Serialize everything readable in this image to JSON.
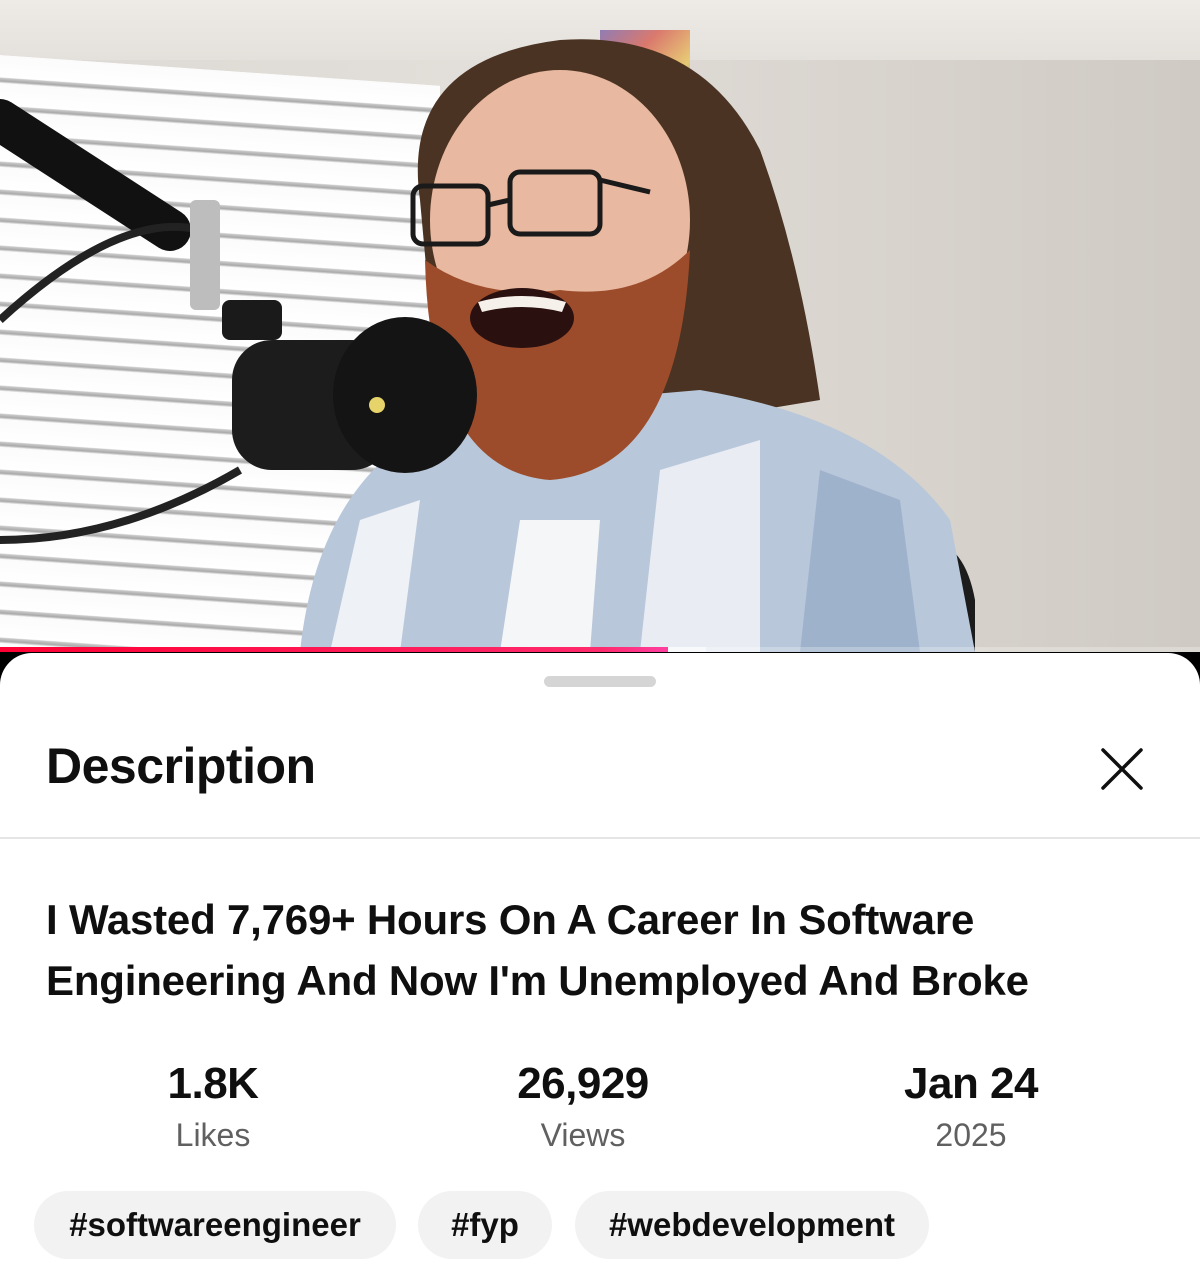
{
  "video": {
    "progress_played": 0.557,
    "progress_buffered": 0.588,
    "accent_color": "#ff0033"
  },
  "sheet": {
    "title": "Description",
    "close_icon": "close-icon"
  },
  "details": {
    "title": "I Wasted 7,769+ Hours On A Career In Software Engineering And Now I'm Unemployed And Broke",
    "stats": [
      {
        "value": "1.8K",
        "label": "Likes"
      },
      {
        "value": "26,929",
        "label": "Views"
      },
      {
        "value": "Jan 24",
        "label": "2025"
      }
    ],
    "hashtags": [
      "#softwareengineer",
      "#fyp",
      "#webdevelopment"
    ]
  }
}
